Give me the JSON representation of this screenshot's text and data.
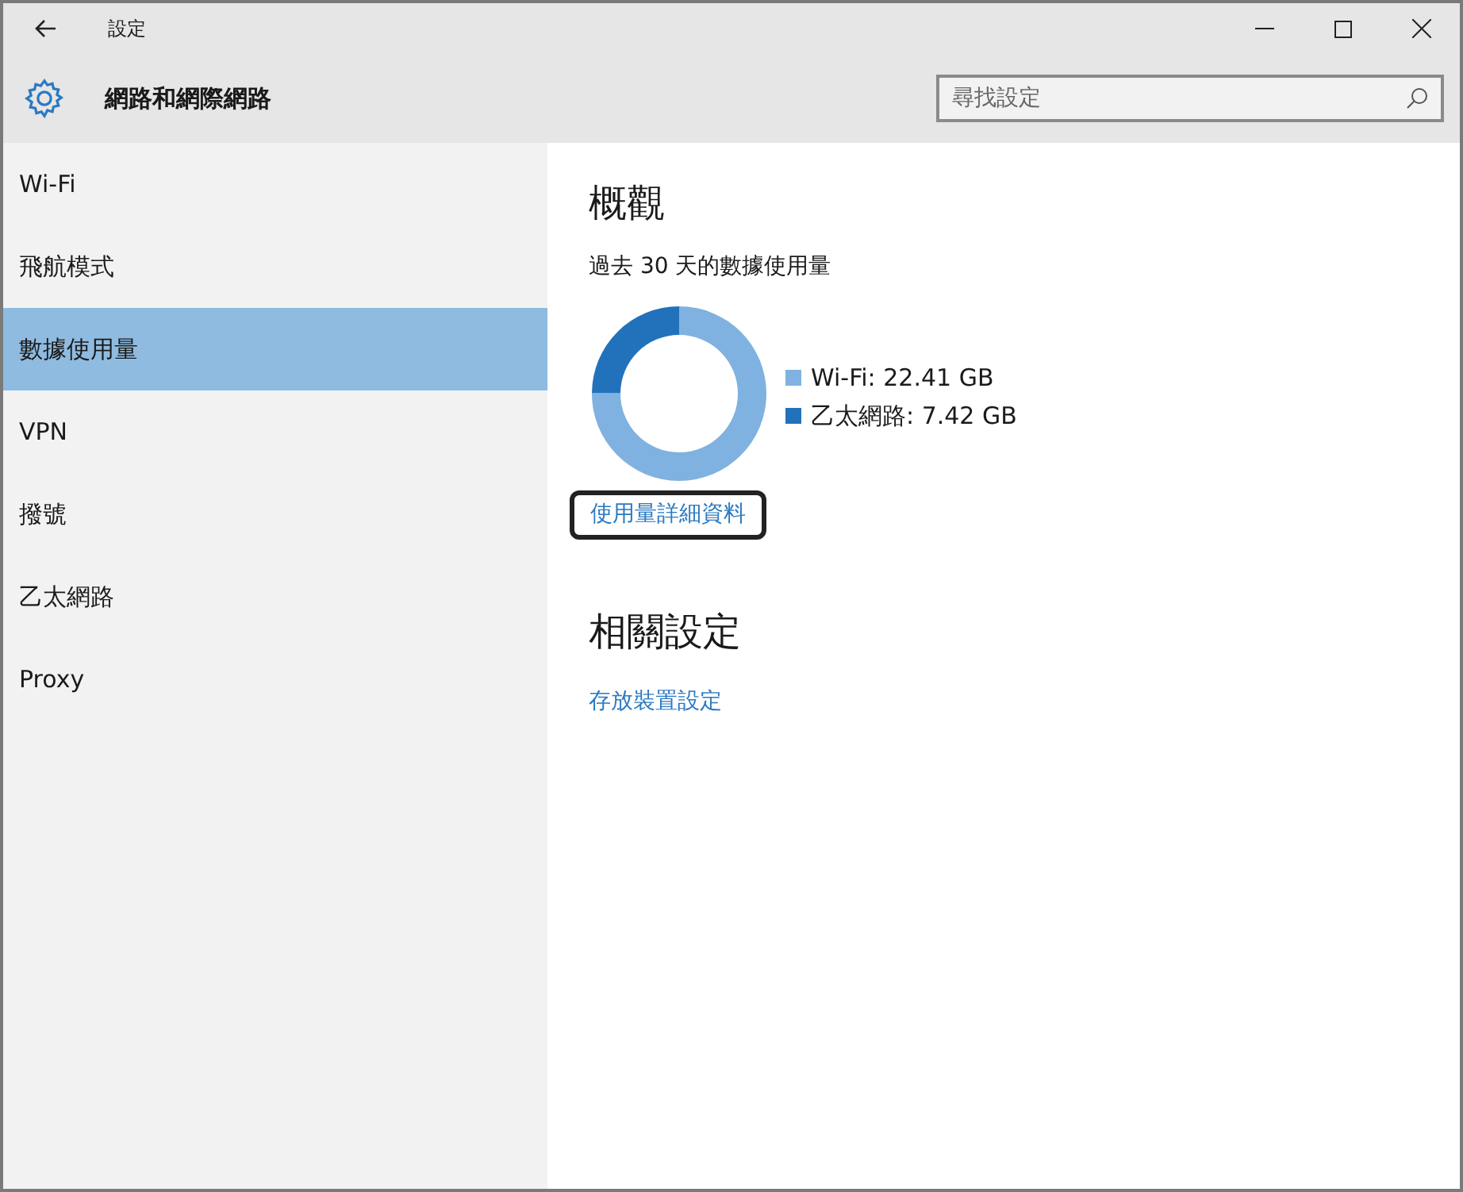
{
  "window": {
    "title": "設定"
  },
  "header": {
    "title": "網路和網際網路",
    "search": {
      "placeholder": "尋找設定"
    }
  },
  "sidebar": {
    "items": [
      {
        "label": "Wi-Fi",
        "selected": false
      },
      {
        "label": "飛航模式",
        "selected": false
      },
      {
        "label": "數據使用量",
        "selected": true
      },
      {
        "label": "VPN",
        "selected": false
      },
      {
        "label": "撥號",
        "selected": false
      },
      {
        "label": "乙太網路",
        "selected": false
      },
      {
        "label": "Proxy",
        "selected": false
      }
    ]
  },
  "overview": {
    "title": "概觀",
    "subtitle": "過去 30 天的數據使用量",
    "chart_data": {
      "type": "donut",
      "values": [
        75.12,
        24.88
      ]
    },
    "legend": [
      {
        "label": "Wi-Fi: 22.41 GB",
        "color": "#7fb2e0"
      },
      {
        "label": "乙太網路: 7.42 GB",
        "color": "#2272bb"
      }
    ],
    "link": {
      "label": "使用量詳細資料",
      "highlighted": true
    }
  },
  "related": {
    "title": "相關設定",
    "links": [
      "存放裝置設定"
    ]
  }
}
